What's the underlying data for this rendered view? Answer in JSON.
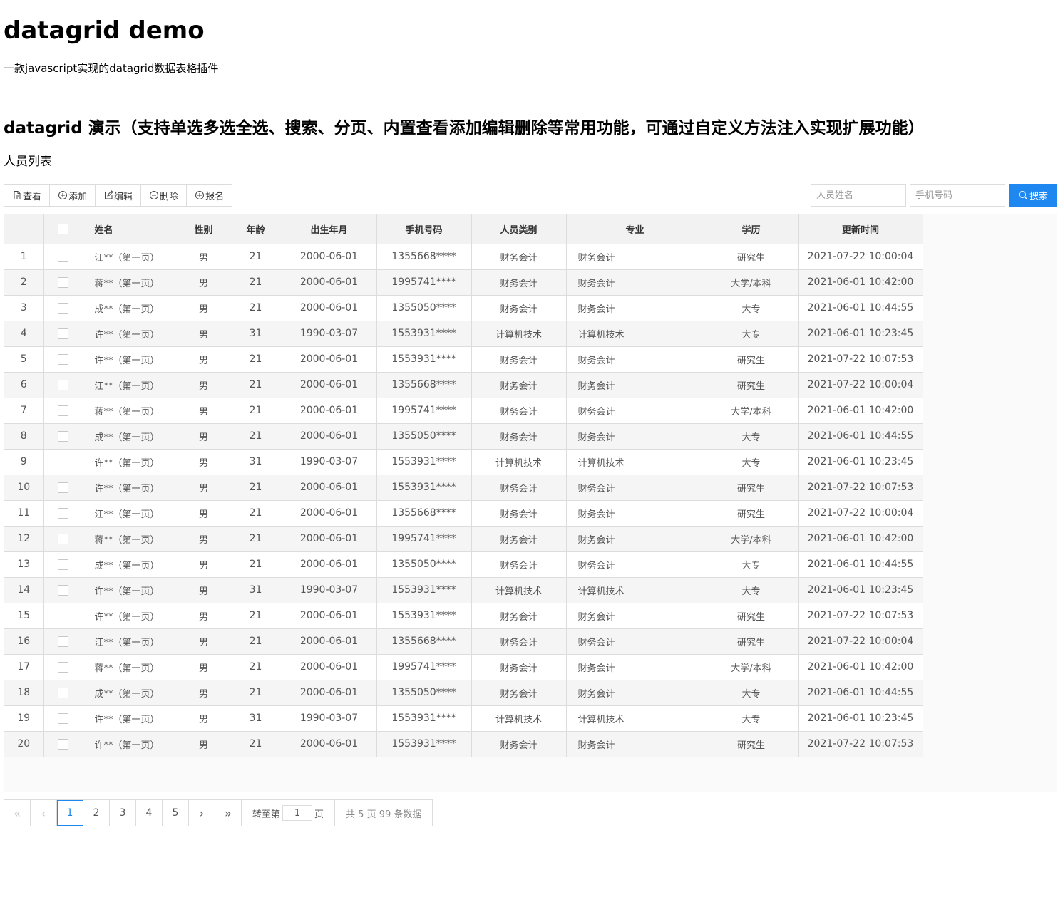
{
  "page": {
    "title": "datagrid demo",
    "description": "一款javascript实现的datagrid数据表格插件",
    "section_title": "datagrid 演示（支持单选多选全选、搜索、分页、内置查看添加编辑删除等常用功能，可通过自定义方法注入实现扩展功能）",
    "list_title": "人员列表"
  },
  "toolbar": [
    {
      "label": "查看",
      "icon": "document-icon"
    },
    {
      "label": "添加",
      "icon": "plus-circle-icon"
    },
    {
      "label": "编辑",
      "icon": "edit-icon"
    },
    {
      "label": "删除",
      "icon": "minus-circle-icon"
    },
    {
      "label": "报名",
      "icon": "plus-circle-icon"
    }
  ],
  "search": {
    "name_placeholder": "人员姓名",
    "phone_placeholder": "手机号码",
    "button_label": "搜索",
    "accent_color": "#1e87f0"
  },
  "table": {
    "columns": [
      "",
      "",
      "姓名",
      "性别",
      "年龄",
      "出生年月",
      "手机号码",
      "人员类别",
      "专业",
      "学历",
      "更新时间"
    ],
    "rows": [
      [
        "1",
        "江**（第一页）",
        "男",
        "21",
        "2000-06-01",
        "1355668****",
        "财务会计",
        "财务会计",
        "研究生",
        "2021-07-22 10:00:04"
      ],
      [
        "2",
        "蒋**（第一页）",
        "男",
        "21",
        "2000-06-01",
        "1995741****",
        "财务会计",
        "财务会计",
        "大学/本科",
        "2021-06-01 10:42:00"
      ],
      [
        "3",
        "成**（第一页）",
        "男",
        "21",
        "2000-06-01",
        "1355050****",
        "财务会计",
        "财务会计",
        "大专",
        "2021-06-01 10:44:55"
      ],
      [
        "4",
        "许**（第一页）",
        "男",
        "31",
        "1990-03-07",
        "1553931****",
        "计算机技术",
        "计算机技术",
        "大专",
        "2021-06-01 10:23:45"
      ],
      [
        "5",
        "许**（第一页）",
        "男",
        "21",
        "2000-06-01",
        "1553931****",
        "财务会计",
        "财务会计",
        "研究生",
        "2021-07-22 10:07:53"
      ],
      [
        "6",
        "江**（第一页）",
        "男",
        "21",
        "2000-06-01",
        "1355668****",
        "财务会计",
        "财务会计",
        "研究生",
        "2021-07-22 10:00:04"
      ],
      [
        "7",
        "蒋**（第一页）",
        "男",
        "21",
        "2000-06-01",
        "1995741****",
        "财务会计",
        "财务会计",
        "大学/本科",
        "2021-06-01 10:42:00"
      ],
      [
        "8",
        "成**（第一页）",
        "男",
        "21",
        "2000-06-01",
        "1355050****",
        "财务会计",
        "财务会计",
        "大专",
        "2021-06-01 10:44:55"
      ],
      [
        "9",
        "许**（第一页）",
        "男",
        "31",
        "1990-03-07",
        "1553931****",
        "计算机技术",
        "计算机技术",
        "大专",
        "2021-06-01 10:23:45"
      ],
      [
        "10",
        "许**（第一页）",
        "男",
        "21",
        "2000-06-01",
        "1553931****",
        "财务会计",
        "财务会计",
        "研究生",
        "2021-07-22 10:07:53"
      ],
      [
        "11",
        "江**（第一页）",
        "男",
        "21",
        "2000-06-01",
        "1355668****",
        "财务会计",
        "财务会计",
        "研究生",
        "2021-07-22 10:00:04"
      ],
      [
        "12",
        "蒋**（第一页）",
        "男",
        "21",
        "2000-06-01",
        "1995741****",
        "财务会计",
        "财务会计",
        "大学/本科",
        "2021-06-01 10:42:00"
      ],
      [
        "13",
        "成**（第一页）",
        "男",
        "21",
        "2000-06-01",
        "1355050****",
        "财务会计",
        "财务会计",
        "大专",
        "2021-06-01 10:44:55"
      ],
      [
        "14",
        "许**（第一页）",
        "男",
        "31",
        "1990-03-07",
        "1553931****",
        "计算机技术",
        "计算机技术",
        "大专",
        "2021-06-01 10:23:45"
      ],
      [
        "15",
        "许**（第一页）",
        "男",
        "21",
        "2000-06-01",
        "1553931****",
        "财务会计",
        "财务会计",
        "研究生",
        "2021-07-22 10:07:53"
      ],
      [
        "16",
        "江**（第一页）",
        "男",
        "21",
        "2000-06-01",
        "1355668****",
        "财务会计",
        "财务会计",
        "研究生",
        "2021-07-22 10:00:04"
      ],
      [
        "17",
        "蒋**（第一页）",
        "男",
        "21",
        "2000-06-01",
        "1995741****",
        "财务会计",
        "财务会计",
        "大学/本科",
        "2021-06-01 10:42:00"
      ],
      [
        "18",
        "成**（第一页）",
        "男",
        "21",
        "2000-06-01",
        "1355050****",
        "财务会计",
        "财务会计",
        "大专",
        "2021-06-01 10:44:55"
      ],
      [
        "19",
        "许**（第一页）",
        "男",
        "31",
        "1990-03-07",
        "1553931****",
        "计算机技术",
        "计算机技术",
        "大专",
        "2021-06-01 10:23:45"
      ],
      [
        "20",
        "许**（第一页）",
        "男",
        "21",
        "2000-06-01",
        "1553931****",
        "财务会计",
        "财务会计",
        "研究生",
        "2021-07-22 10:07:53"
      ]
    ]
  },
  "pagination": {
    "first": "«",
    "prev": "‹",
    "pages": [
      "1",
      "2",
      "3",
      "4",
      "5"
    ],
    "current": "1",
    "next": "›",
    "last": "»",
    "jump_prefix": "转至第",
    "jump_value": "1",
    "jump_suffix": "页",
    "total_text": "共 5 页 99 条数据"
  }
}
